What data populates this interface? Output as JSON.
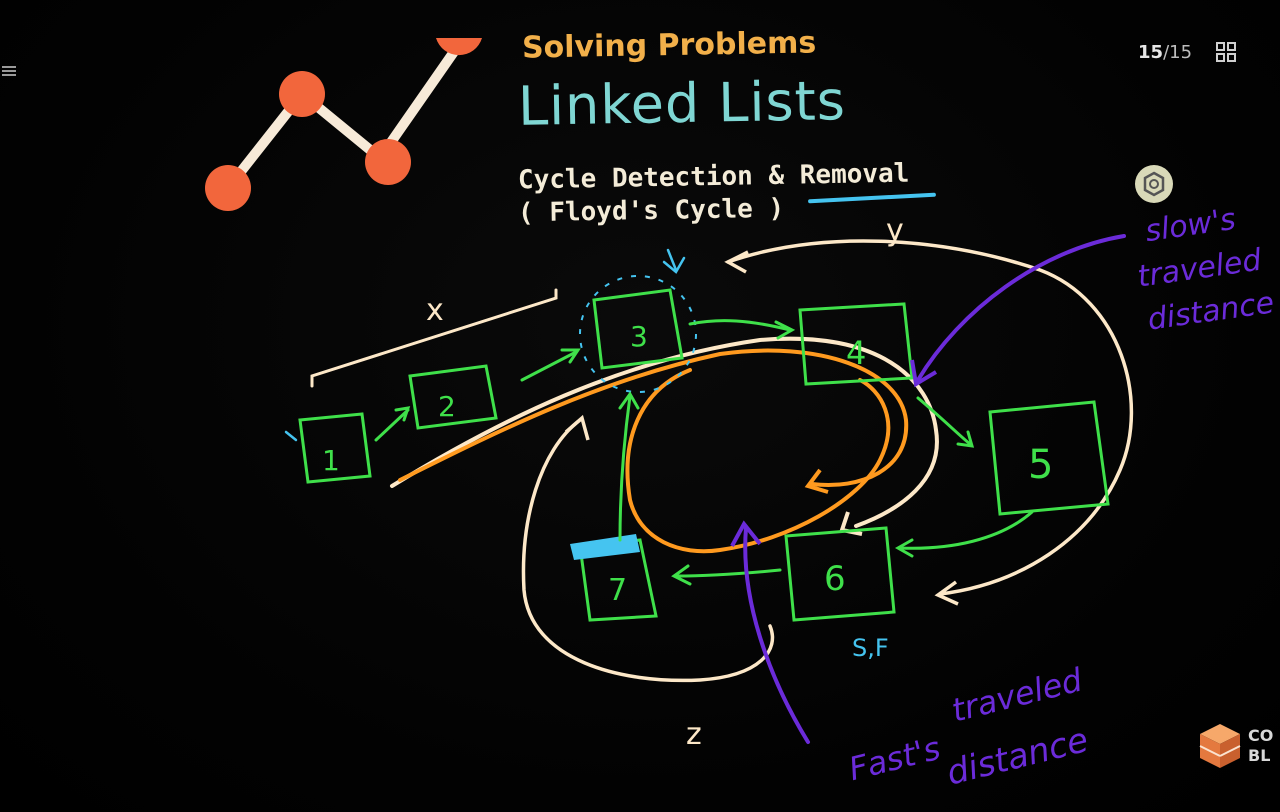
{
  "slide": {
    "title_small": "Solving Problems",
    "title_big": "Linked Lists",
    "subtitle_line1_a": "Cycle Detection & ",
    "subtitle_line1_b": "Removal",
    "subtitle_line2": "( Floyd's Cycle )",
    "page_current": "15",
    "page_separator": "/",
    "page_total": "15"
  },
  "diagram": {
    "nodes": [
      "1",
      "2",
      "3",
      "4",
      "5",
      "6",
      "7"
    ],
    "label_x": "x",
    "label_y": "y",
    "label_z": "z",
    "label_sf": "S,F",
    "annotation_slow": [
      "slow's",
      "traveled",
      "distance"
    ],
    "annotation_fast": [
      "Fast's",
      "traveled",
      "distance"
    ]
  },
  "brand": {
    "line1": "CO",
    "line2": "BL"
  },
  "icons": {
    "menu": "menu-icon",
    "grid": "grid-view-icon",
    "settings": "settings-hex-icon",
    "logo": "line-chart-logo-icon",
    "brand": "cube-logo-icon"
  },
  "colors": {
    "background": "#050505",
    "title_small": "#f2b04a",
    "title_big": "#7fd6d3",
    "node_green": "#3fe04a",
    "cream_pen": "#fde8c8",
    "orange_pen": "#ff9a1f",
    "purple_pen": "#6b2bd9",
    "cyan_pen": "#45c4f0"
  }
}
